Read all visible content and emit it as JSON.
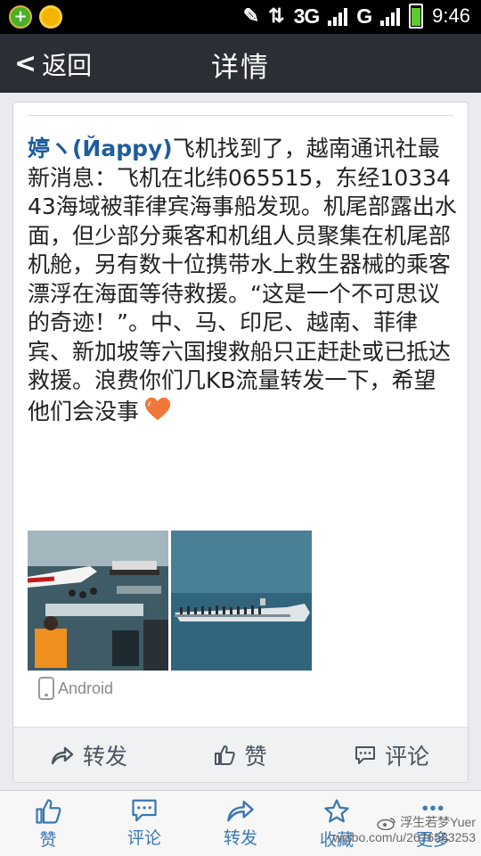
{
  "status_bar": {
    "network_3g": "3G",
    "network_g": "G",
    "time": "9:46",
    "battery_level": 0.85
  },
  "nav": {
    "back_label": "返回",
    "title": "详情"
  },
  "post": {
    "author": "婷ヽ(Йappy)",
    "body": "飞机找到了，越南通讯社最新消息：飞机在北纬065515，东经1033443海域被菲律宾海事船发现。机尾部露出水面，但少部分乘客和机组人员聚集在机尾部机舱，另有数十位携带水上救生器械的乘客漂浮在海面等待救援。“这是一个不可思议的奇迹！”。中、马、印尼、越南、菲律宾、新加坡等六国搜救船只正赶赴或已抵达救援。浪费你们几KB流量转发一下，希望他们会没事",
    "source": "Android"
  },
  "actions": {
    "repost": "转发",
    "like": "赞",
    "comment": "评论"
  },
  "tabs": {
    "like": "赞",
    "comment": "评论",
    "repost": "转发",
    "favorite": "收藏",
    "more": "更多"
  },
  "watermark": {
    "line1": "浮生若梦Yuer",
    "line2": "weibo.com/u/2676583253"
  },
  "colors": {
    "navbar": "#2b2e35",
    "author": "#1f5c9c",
    "tab_accent": "#3b78b3"
  }
}
